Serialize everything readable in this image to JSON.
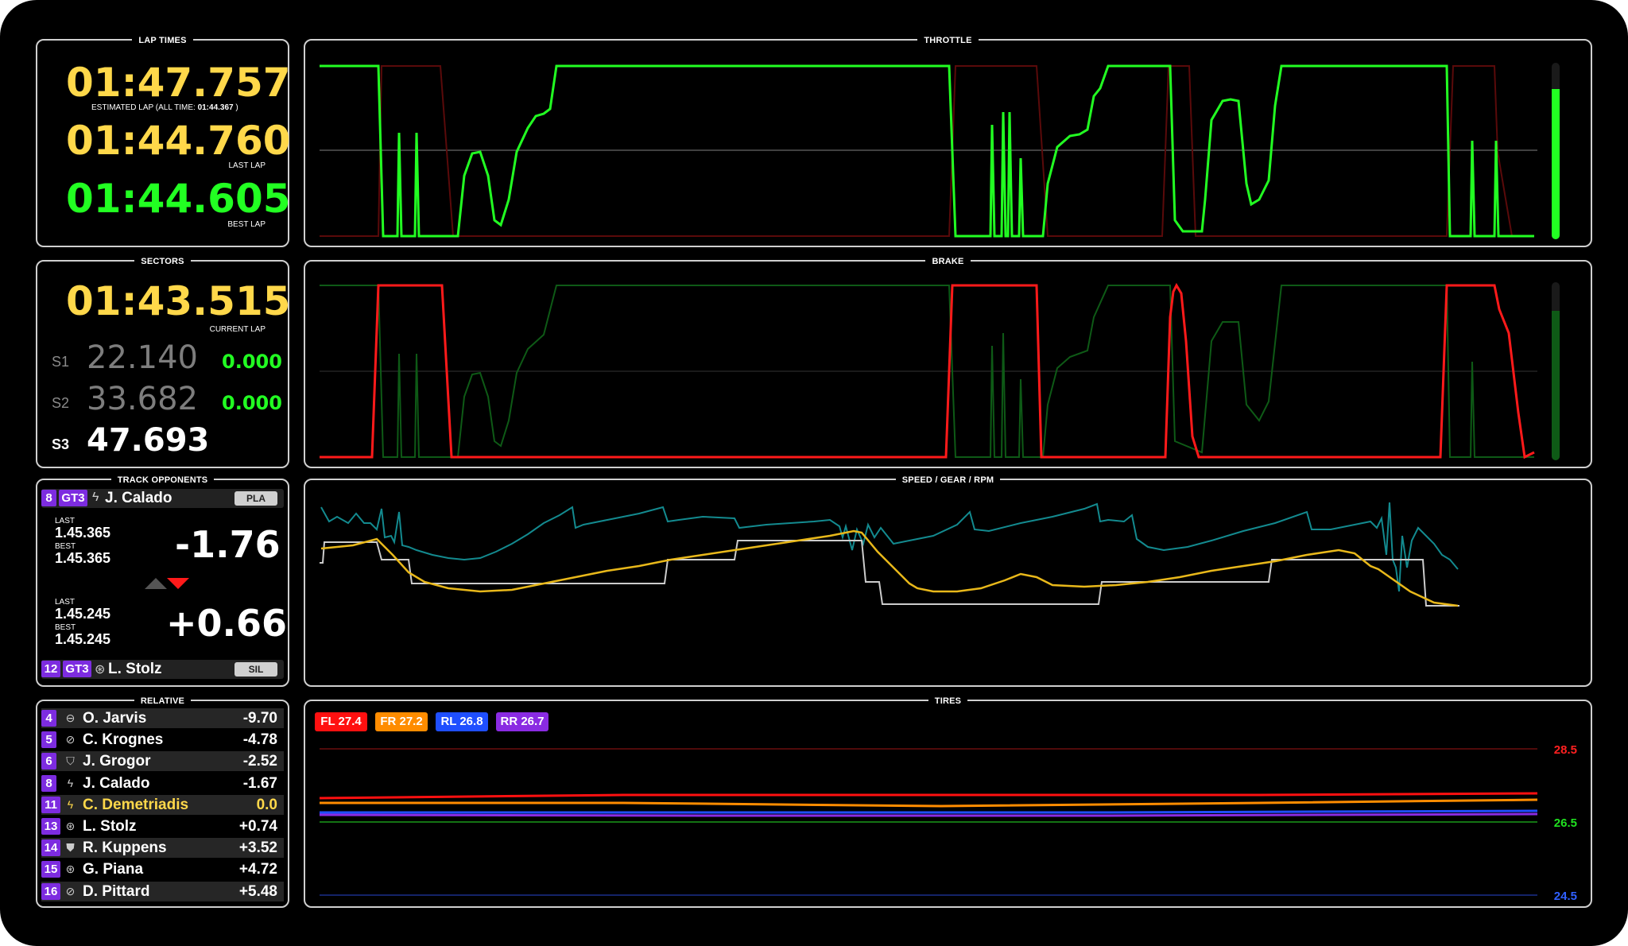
{
  "lap_times": {
    "title": "LAP TIMES",
    "estimated": "01:47.757",
    "estimated_label": "ESTIMATED LAP (ALL TIME: ",
    "all_time": "01:44.367",
    "estimated_label_end": " )",
    "last": "01:44.760",
    "last_label": "LAST LAP",
    "best": "01:44.605",
    "best_label": "BEST LAP"
  },
  "sectors": {
    "title": "SECTORS",
    "current": "01:43.515",
    "current_label": "CURRENT LAP",
    "rows": [
      {
        "label": "S1",
        "time": "22.140",
        "delta": "0.000"
      },
      {
        "label": "S2",
        "time": "33.682",
        "delta": "0.000"
      },
      {
        "label": "S3",
        "time": "47.693",
        "delta": ""
      }
    ]
  },
  "track_opponents": {
    "title": "TRACK OPPONENTS",
    "ahead": {
      "pos": "8",
      "class": "GT3",
      "name": "J. Calado",
      "tag": "PLA",
      "last_label": "LAST",
      "last": "1.45.365",
      "best_label": "BEST",
      "best": "1.45.365",
      "gap": "-1.76"
    },
    "behind": {
      "pos": "12",
      "class": "GT3",
      "name": "L. Stolz",
      "tag": "SIL",
      "last_label": "LAST",
      "last": "1.45.245",
      "best_label": "BEST",
      "best": "1.45.245",
      "gap": "+0.66"
    }
  },
  "relative": {
    "title": "RELATIVE",
    "rows": [
      {
        "pos": "4",
        "icon": "minus-circle-icon",
        "glyph": "⊖",
        "name": "O. Jarvis",
        "gap": "-9.70"
      },
      {
        "pos": "5",
        "icon": "wheel-icon",
        "glyph": "⊘",
        "name": "C. Krognes",
        "gap": "-4.78"
      },
      {
        "pos": "6",
        "icon": "shield-icon",
        "glyph": "⛉",
        "name": "J. Grogor",
        "gap": "-2.52"
      },
      {
        "pos": "8",
        "icon": "lightning-icon",
        "glyph": "ϟ",
        "name": "J. Calado",
        "gap": "-1.67"
      },
      {
        "pos": "11",
        "icon": "lightning-icon",
        "glyph": "ϟ",
        "name": "C. Demetriadis",
        "gap": "0.0"
      },
      {
        "pos": "13",
        "icon": "star-circle-icon",
        "glyph": "⊛",
        "name": "L. Stolz",
        "gap": "+0.74"
      },
      {
        "pos": "14",
        "icon": "shield-icon",
        "glyph": "⛊",
        "name": "R. Kuppens",
        "gap": "+3.52"
      },
      {
        "pos": "15",
        "icon": "star-circle-icon",
        "glyph": "⊛",
        "name": "G. Piana",
        "gap": "+4.72"
      },
      {
        "pos": "16",
        "icon": "wheel-icon",
        "glyph": "⊘",
        "name": "D. Pittard",
        "gap": "+5.48"
      }
    ],
    "player_index": 4
  },
  "throttle": {
    "title": "THROTTLE",
    "level": 0.85
  },
  "brake": {
    "title": "BRAKE",
    "level": 0.84
  },
  "speed": {
    "title": "SPEED / GEAR / RPM"
  },
  "tires": {
    "title": "TIRES",
    "chips": [
      {
        "label": "FL 27.4",
        "color": "#ff1010"
      },
      {
        "label": "FR 27.2",
        "color": "#ff8c00"
      },
      {
        "label": "RL 26.8",
        "color": "#1f4fff"
      },
      {
        "label": "RR 26.7",
        "color": "#8a2be2"
      }
    ],
    "axis_labels": [
      {
        "value": "28.5",
        "color": "#ff2020"
      },
      {
        "value": "26.5",
        "color": "#20e020"
      },
      {
        "value": "24.5",
        "color": "#3060ff"
      }
    ]
  },
  "colors": {
    "yellow": "#ffd84a",
    "green": "#22ff22",
    "red": "#ff1a1a",
    "purple": "#7d2ce0",
    "teal": "#138a8f",
    "gold": "#e8b81a"
  }
}
